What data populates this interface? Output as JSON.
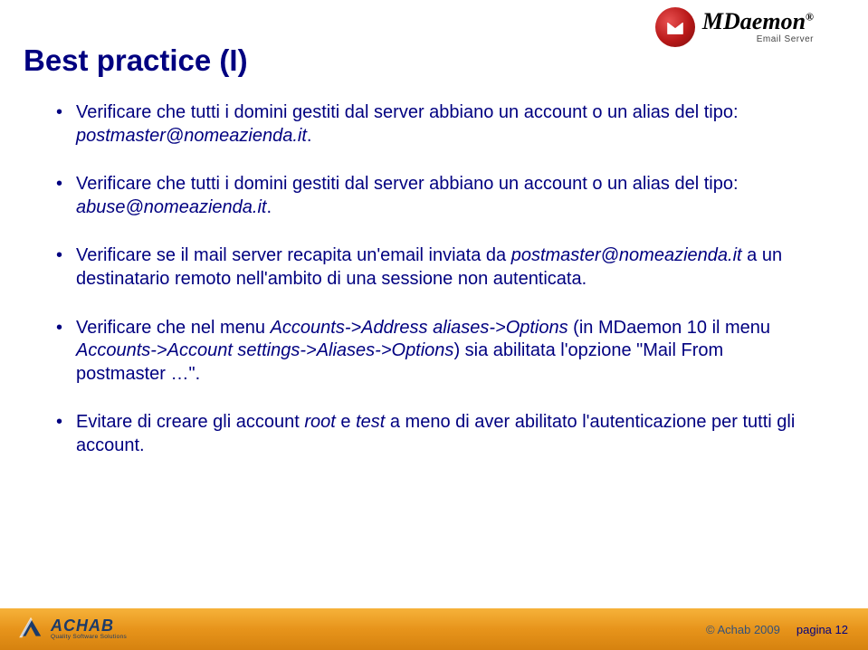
{
  "header": {
    "product_name": "MDaemon",
    "product_reg": "®",
    "product_sub": "Email Server"
  },
  "title": "Best practice (I)",
  "bullets": [
    {
      "pre": "Verificare che tutti i domini gestiti dal server abbiano un account o un alias del tipo: ",
      "ital": "postmaster@nomeazienda.it",
      "post": "."
    },
    {
      "pre": "Verificare che tutti i domini gestiti dal server abbiano un account o un alias del tipo: ",
      "ital": "abuse@nomeazienda.it",
      "post": "."
    },
    {
      "pre": "Verificare se il mail server recapita un'email inviata da ",
      "ital": "postmaster@nomeazienda.it",
      "post": " a un destinatario remoto nell'ambito di una sessione non autenticata."
    },
    {
      "pre": "Verificare che nel menu ",
      "ital": "Accounts->Address aliases->Options",
      "mid": " (in MDaemon 10 il menu ",
      "ital2": "Accounts->Account settings->Aliases->Options",
      "post2": ") sia abilitata l'opzione \"Mail From postmaster …\"."
    },
    {
      "pre": "Evitare di creare gli account ",
      "ital": "root",
      "mid": " e ",
      "ital2": "test",
      "post2": " a meno di aver abilitato l'autenticazione per tutti gli account."
    }
  ],
  "footer": {
    "brand": "ACHAB",
    "tagline": "Quality Software Solutions",
    "copyright": "© Achab 2009",
    "page_label": "pagina 12"
  }
}
